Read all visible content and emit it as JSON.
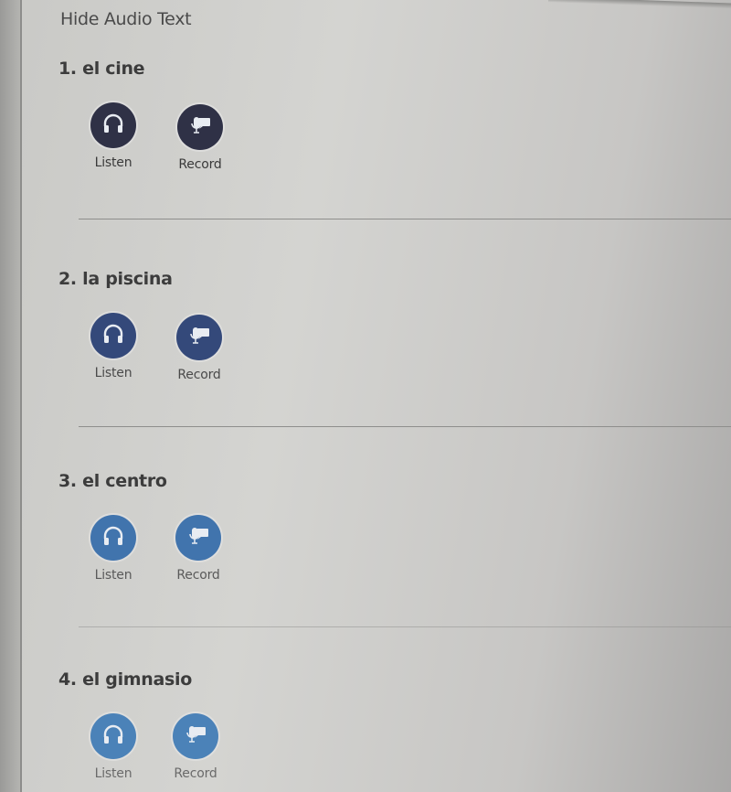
{
  "hide_audio_text": "Hide Audio Text",
  "items": [
    {
      "title": "1. el cine",
      "listen_label": "Listen",
      "record_label": "Record",
      "color": "#2f3146",
      "label_color": "#3a3a3a"
    },
    {
      "title": "2. la piscina",
      "listen_label": "Listen",
      "record_label": "Record",
      "color": "#34497a",
      "label_color": "#4a4a4a"
    },
    {
      "title": "3. el centro",
      "listen_label": "Listen",
      "record_label": "Record",
      "color": "#4174ad",
      "label_color": "#5a5a5a"
    },
    {
      "title": "4. el gimnasio",
      "listen_label": "Listen",
      "record_label": "Record",
      "color": "#4b82b8",
      "label_color": "#6a6a6a"
    }
  ],
  "icons": {
    "listen": "headphones-icon",
    "record": "microphone-speech-icon"
  }
}
